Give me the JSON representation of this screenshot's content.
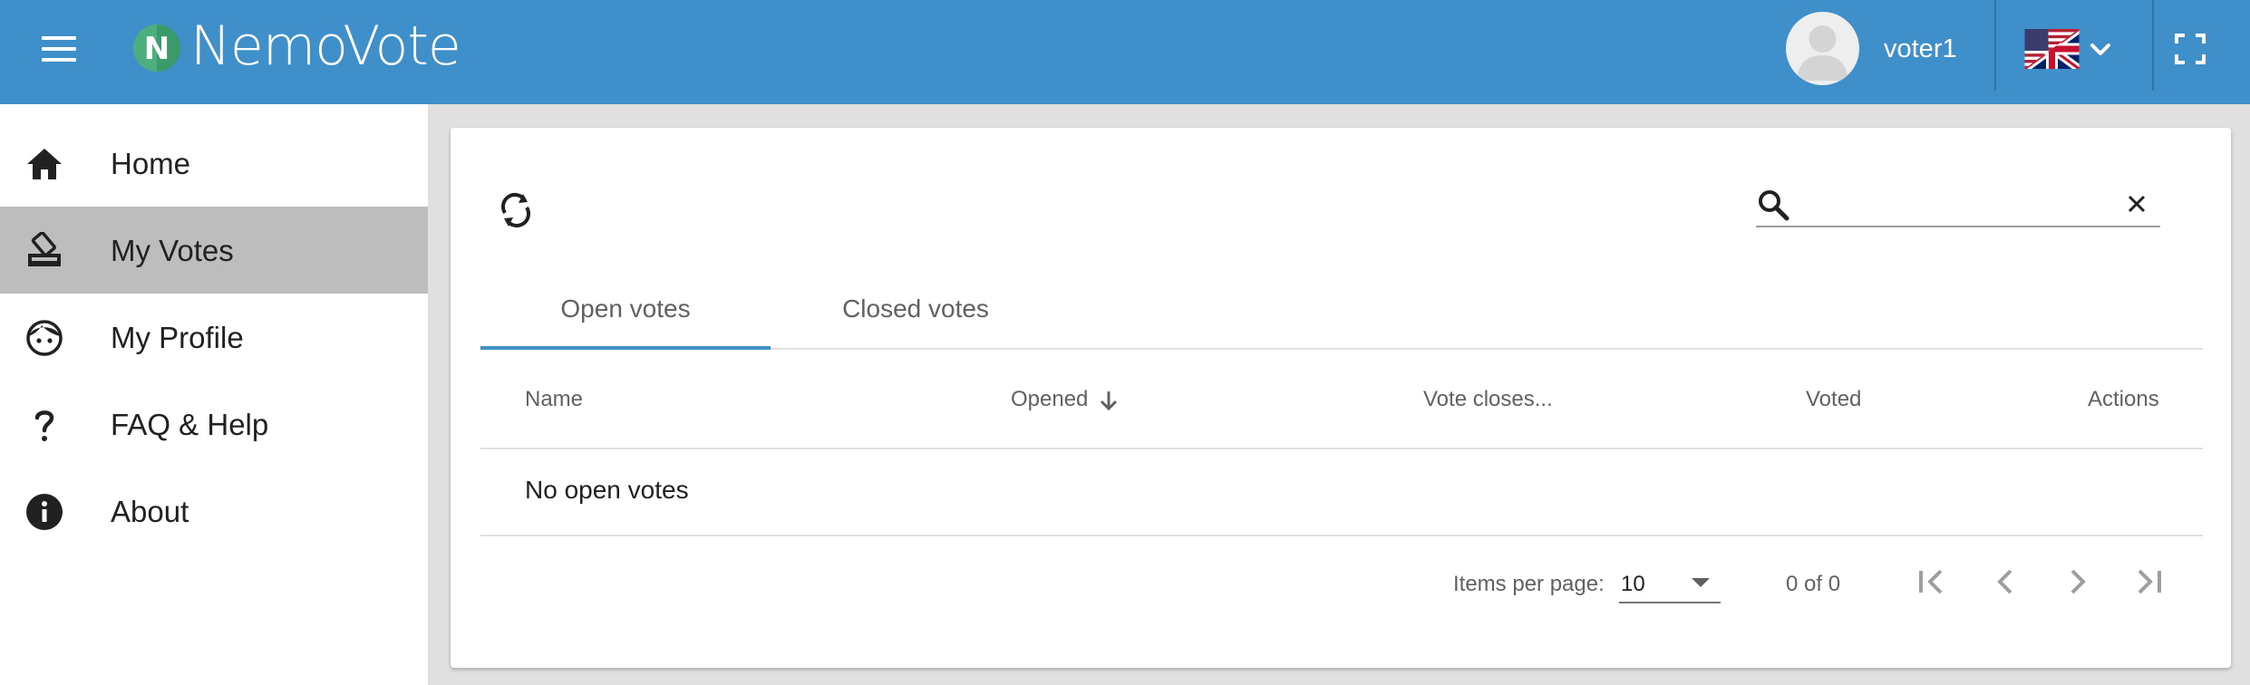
{
  "app": {
    "logo_letter": "N",
    "logo_text": "NemoVote"
  },
  "header": {
    "username": "voter1",
    "menu_icon": "menu-icon",
    "language_flag": "uk-flag-icon",
    "fullscreen_icon": "fullscreen-icon"
  },
  "sidebar": {
    "items": [
      {
        "label": "Home",
        "icon": "home-icon"
      },
      {
        "label": "My Votes",
        "icon": "ballot-box-icon",
        "active": true
      },
      {
        "label": "My Profile",
        "icon": "face-icon"
      },
      {
        "label": "FAQ & Help",
        "icon": "question-mark-icon"
      },
      {
        "label": "About",
        "icon": "info-icon"
      }
    ]
  },
  "toolbar": {
    "refresh_icon": "refresh-icon",
    "search": {
      "value": "",
      "placeholder": ""
    }
  },
  "tabs": [
    {
      "label": "Open votes",
      "active": true
    },
    {
      "label": "Closed votes",
      "active": false
    }
  ],
  "table": {
    "columns": [
      "Name",
      "Opened",
      "Vote closes...",
      "Voted",
      "Actions"
    ],
    "sorted_column": "Opened",
    "sort_direction": "descending",
    "empty_message": "No open votes"
  },
  "paginator": {
    "items_per_page_label": "Items per page:",
    "items_per_page_value": "10",
    "range_label": "0 of 0"
  },
  "colors": {
    "primary": "#3f8fcb",
    "active_nav": "#bdbdbd",
    "background": "#e0e0e0"
  }
}
